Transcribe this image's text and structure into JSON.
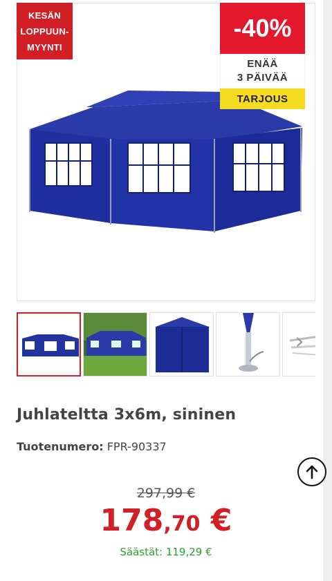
{
  "badges": {
    "season_line1": "KESÄN",
    "season_line2": "LOPPUUN-",
    "season_line3": "MYYNTI",
    "discount": "-40%",
    "days_line1": "ENÄÄ",
    "days_line2": "3 PÄIVÄÄ",
    "deal": "TARJOUS"
  },
  "gallery": {
    "main_image": "blue-party-tent-image",
    "thumbnails": [
      "tent-white-bg",
      "tent-in-garden",
      "tent-side-wall",
      "tent-pole-foot",
      "tent-parts"
    ],
    "next_icon": "chevron-right-icon"
  },
  "product": {
    "title": "Juhlateltta 3x6m, sininen",
    "sku_label": "Tuotenumero:",
    "sku_value": "FPR-90337"
  },
  "pricing": {
    "old_price": "297,99 €",
    "price_int": "178",
    "price_dec": ",70",
    "price_currency": " €",
    "savings": "Säästät: 119,29 €"
  },
  "colors": {
    "sale_red": "#d21f26",
    "deal_yellow": "#f6dc20",
    "savings_green": "#2aa12a",
    "tent_blue": "#1f2e9c"
  },
  "scroll_top_icon": "arrow-up-circle-icon"
}
